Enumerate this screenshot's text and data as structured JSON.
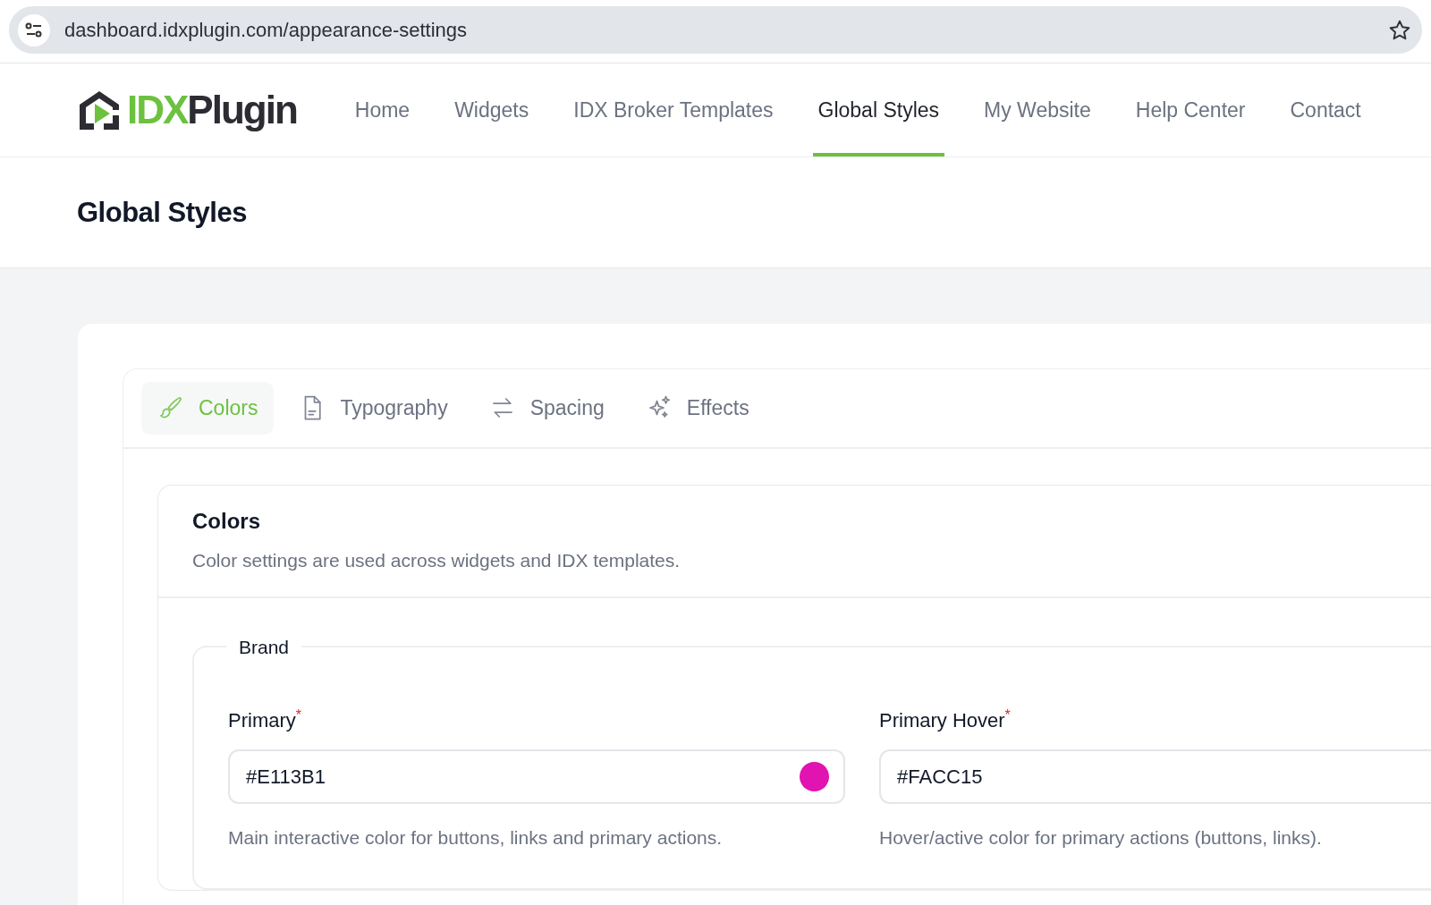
{
  "browser": {
    "url": "dashboard.idxplugin.com/appearance-settings"
  },
  "logo": {
    "parts": [
      {
        "text": "IDX",
        "kind": "accent"
      },
      {
        "text": "Plugin",
        "kind": "base"
      }
    ]
  },
  "nav": [
    {
      "label": "Home",
      "selected": false
    },
    {
      "label": "Widgets",
      "selected": false
    },
    {
      "label": "IDX Broker Templates",
      "selected": false
    },
    {
      "label": "Global Styles",
      "selected": true
    },
    {
      "label": "My Website",
      "selected": false
    },
    {
      "label": "Help Center",
      "selected": false
    },
    {
      "label": "Contact",
      "selected": false
    }
  ],
  "page_title": "Global Styles",
  "tabs": [
    {
      "label": "Colors",
      "kind": "brush",
      "selected": true
    },
    {
      "label": "Typography",
      "kind": "document",
      "selected": false
    },
    {
      "label": "Spacing",
      "kind": "arrows",
      "selected": false
    },
    {
      "label": "Effects",
      "kind": "sparkles",
      "selected": false
    }
  ],
  "section": {
    "title": "Colors",
    "description": "Color settings are used across widgets and IDX templates.",
    "group": {
      "legend": "Brand",
      "fields": [
        {
          "label": "Primary",
          "required_mark": "*",
          "value": "#E113B1",
          "color": "#e113b1",
          "help": "Main interactive color for buttons, links and primary actions."
        },
        {
          "label": "Primary Hover",
          "required_mark": "*",
          "value": "#FACC15",
          "help": "Hover/active color for primary actions (buttons, links)."
        }
      ]
    }
  }
}
